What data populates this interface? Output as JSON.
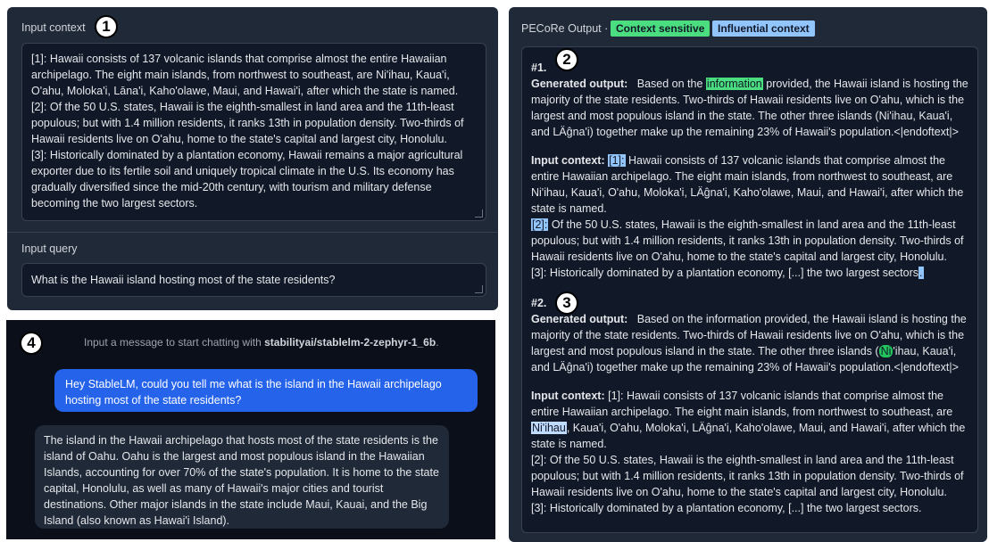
{
  "markers": [
    "1",
    "2",
    "3",
    "4"
  ],
  "input_context": {
    "label": "Input context",
    "paragraphs": [
      "[1]: Hawaii consists of 137 volcanic islands that comprise almost the entire Hawaiian archipelago. The eight main islands, from northwest to southeast, are Ni'ihau, Kaua'i, O'ahu, Moloka'i, Lāna'i, Kaho'olawe, Maui, and Hawai'i, after which the state is named.",
      "[2]: Of the 50 U.S. states, Hawaii is the eighth-smallest in land area and the 11th-least populous; but with 1.4 million residents, it ranks 13th in population density. Two-thirds of Hawaii residents live on O'ahu, home to the state's capital and largest city, Honolulu.",
      "[3]: Historically dominated by a plantation economy, Hawaii remains a major agricultural exporter due to its fertile soil and uniquely tropical climate in the U.S. Its economy has gradually diversified since the mid-20th century, with tourism and military defense becoming the two largest sectors."
    ]
  },
  "input_query": {
    "label": "Input query",
    "value": "What is the Hawaii island hosting most of the state residents?"
  },
  "chat": {
    "hint_prefix": "Input a message to start chatting with ",
    "hint_model": "stabilityai/stablelm-2-zephyr-1_6b",
    "hint_suffix": ".",
    "user_message": "Hey StableLM, could you tell me what is the island in the Hawaii archipelago hosting most of the state residents?",
    "bot_message": "The island in the Hawaii archipelago that hosts most of the state residents is the island of Oahu. Oahu is the largest and most populous island in the Hawaiian Islands, accounting for over 70% of the state's population. It is home to the state capital, Honolulu, as well as many of Hawaii's major cities and tourist destinations. Other major islands in the state include Maui, Kauai, and the Big Island (also known as Hawai'i Island)."
  },
  "output": {
    "title": "PECoRe Output",
    "separator": "·",
    "tag_context_sensitive": "Context sensitive",
    "tag_influential": "Influential context",
    "colors": {
      "context_sensitive": "#4ade80",
      "influential": "#93c5fd"
    },
    "ex1": {
      "num": "#1.",
      "gen_label": "Generated output:",
      "gen_pre": "Based on the ",
      "gen_hl": "information",
      "gen_post": " provided, the Hawaii island is hosting the majority of the state residents. Two-thirds of Hawaii residents live on O'ahu, which is the largest and most populous island in the state. The other three islands (Ni'ihau, Kaua'i, and LÄĝna'i) together make up the remaining 23% of Hawaii's population.<|endoftext|>",
      "ctx_label": "Input context:",
      "ctx1_hl": "[1]:",
      "ctx1_rest": " Hawaii consists of 137 volcanic islands that comprise almost the entire Hawaiian archipelago. The eight main islands, from northwest to southeast, are Ni'ihau, Kaua'i, O'ahu, Moloka'i, LÄĝna'i, Kaho'olawe, Maui, and Hawai'i, after which the state is named.",
      "ctx2_hl": "[2]:",
      "ctx2_rest": " Of the 50 U.S. states, Hawaii is the eighth-smallest in land area and the 11th-least populous; but with 1.4 million residents, it ranks 13th in population density. Two-thirds of Hawaii residents live on O'ahu, home to the state's capital and largest city, Honolulu.",
      "ctx3_pre": "[3]: Historically dominated by a plantation economy, [...] the two largest sectors",
      "ctx3_hl": "."
    },
    "ex2": {
      "num": "#2.",
      "gen_label": "Generated output:",
      "gen_pre": "Based on the information provided, the Hawaii island is hosting the majority of the state residents. Two-thirds of Hawaii residents live on O'ahu, which is the largest and most populous island in the state. The other three islands (",
      "gen_hl": "Ni",
      "gen_post": "'ihau, Kaua'i, and LÄĝna'i) together make up the remaining 23% of Hawaii's population.<|endoftext|>",
      "ctx_label": "Input context:",
      "ctx1_pre": " [1]: Hawaii consists of 137 volcanic islands that comprise almost the entire Hawaiian archipelago. The eight main islands, from northwest to southeast, are ",
      "ctx1_hl": "Ni'ihau",
      "ctx1_post": ", Kaua'i, O'ahu, Moloka'i, LÄĝna'i, Kaho'olawe, Maui, and Hawai'i, after which the state is named.",
      "ctx2": "[2]: Of the 50 U.S. states, Hawaii is the eighth-smallest in land area and the 11th-least populous; but with 1.4 million residents, it ranks 13th in population density. Two-thirds of Hawaii residents live on O'ahu, home to the state's capital and largest city, Honolulu.",
      "ctx3": "[3]: Historically dominated by a plantation economy, [...] the two largest sectors."
    }
  }
}
